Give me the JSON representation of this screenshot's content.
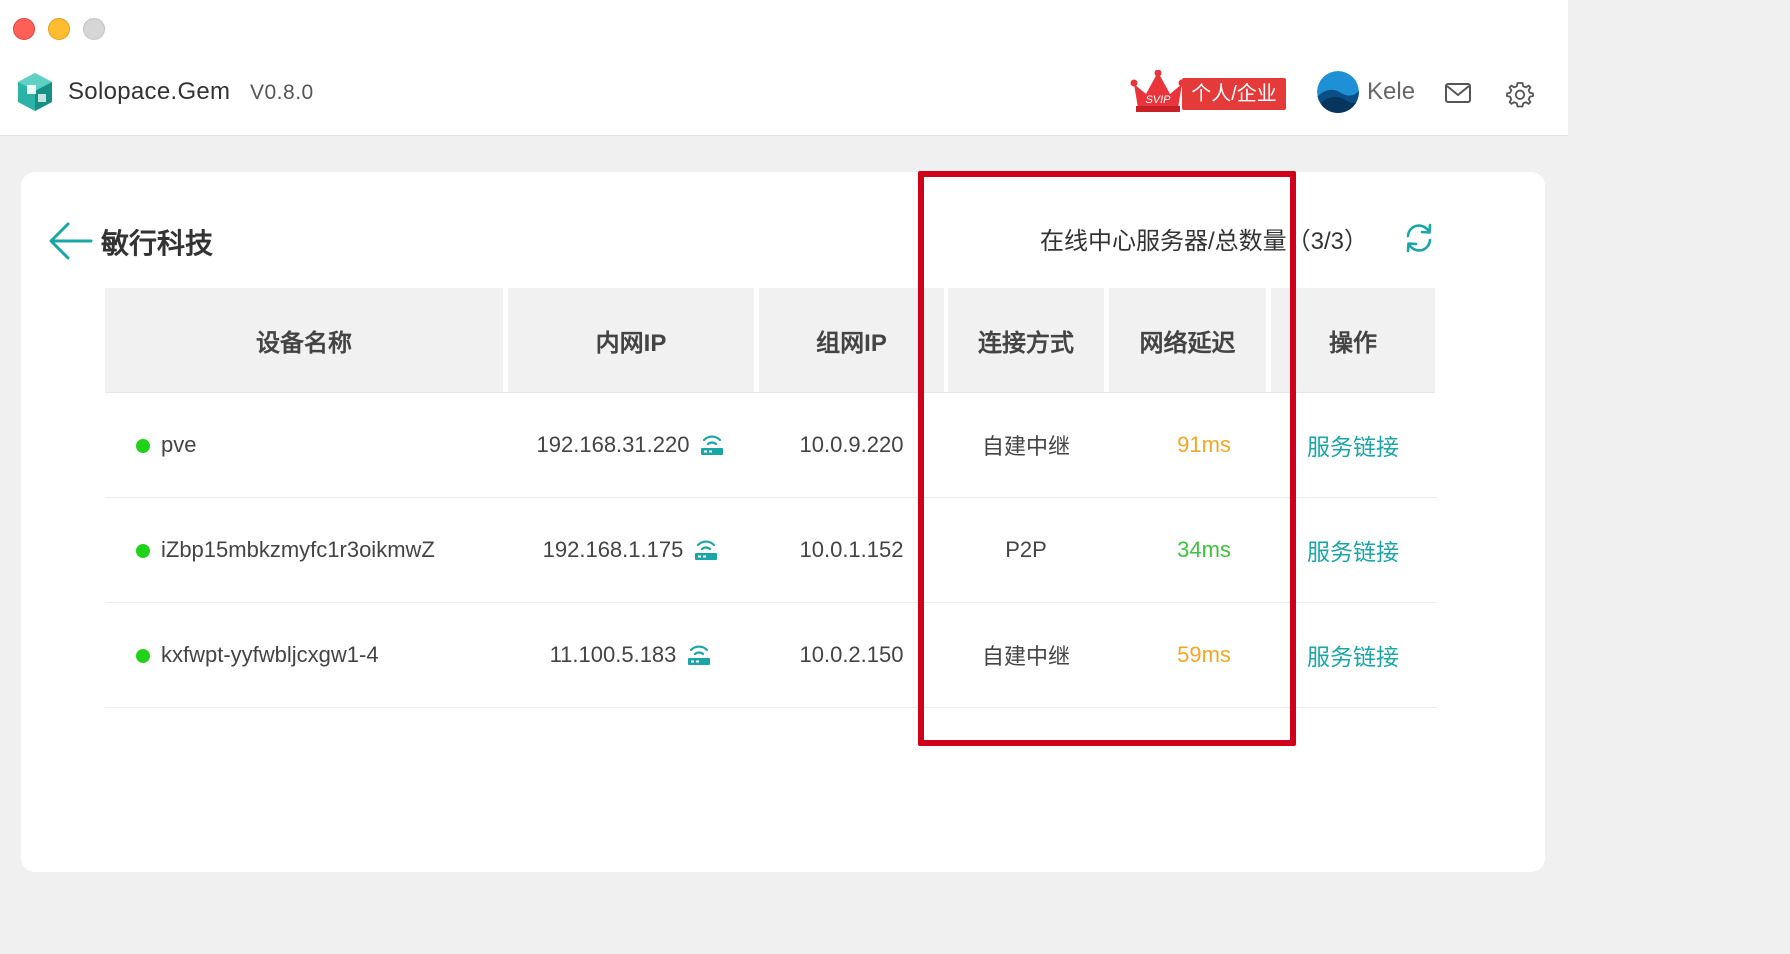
{
  "window": {
    "app_name": "Solopace.Gem",
    "version": "V0.8.0"
  },
  "header": {
    "svip_label": "SVIP",
    "plan_label": "个人/企业",
    "username": "Kele"
  },
  "page": {
    "title": "敏行科技",
    "summary": "在线中心服务器/总数量（3/3）"
  },
  "table": {
    "columns": [
      "设备名称",
      "内网IP",
      "组网IP",
      "连接方式",
      "网络延迟",
      "操作"
    ],
    "rows": [
      {
        "name": "pve",
        "lan_ip": "192.168.31.220",
        "net_ip": "10.0.9.220",
        "connection": "自建中继",
        "latency": "91ms",
        "latency_color": "#f5a623",
        "action": "服务链接",
        "online": true
      },
      {
        "name": "iZbp15mbkzmyfc1r3oikmwZ",
        "lan_ip": "192.168.1.175",
        "net_ip": "10.0.1.152",
        "connection": "P2P",
        "latency": "34ms",
        "latency_color": "#3cc43c",
        "action": "服务链接",
        "online": true
      },
      {
        "name": "kxfwpt-yyfwbljcxgw1-4",
        "lan_ip": "11.100.5.183",
        "net_ip": "10.0.2.150",
        "connection": "自建中继",
        "latency": "59ms",
        "latency_color": "#f5a623",
        "action": "服务链接",
        "online": true
      }
    ]
  },
  "colors": {
    "accent": "#1aa6a6",
    "online": "#21d21b",
    "highlight": "#d0021b"
  },
  "icons": [
    "app-logo-icon",
    "crown-icon",
    "avatar",
    "mail-icon",
    "gear-icon",
    "back-arrow-icon",
    "refresh-icon",
    "router-icon"
  ]
}
